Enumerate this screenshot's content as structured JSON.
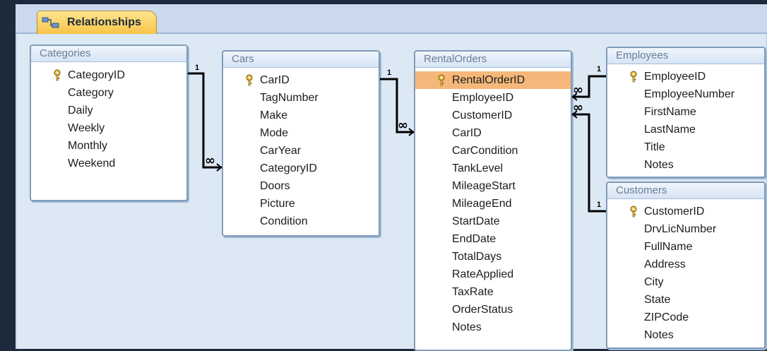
{
  "tab": {
    "label": "Relationships",
    "icon": "relationships-icon"
  },
  "tables": [
    {
      "name": "Categories",
      "fields": [
        "CategoryID",
        "Category",
        "Daily",
        "Weekly",
        "Monthly",
        "Weekend"
      ],
      "key": 0
    },
    {
      "name": "Cars",
      "fields": [
        "CarID",
        "TagNumber",
        "Make",
        "Mode",
        "CarYear",
        "CategoryID",
        "Doors",
        "Picture",
        "Condition"
      ],
      "key": 0
    },
    {
      "name": "RentalOrders",
      "fields": [
        "RentalOrderID",
        "EmployeeID",
        "CustomerID",
        "CarID",
        "CarCondition",
        "TankLevel",
        "MileageStart",
        "MileageEnd",
        "StartDate",
        "EndDate",
        "TotalDays",
        "RateApplied",
        "TaxRate",
        "OrderStatus",
        "Notes"
      ],
      "key": 0,
      "selected": 0
    },
    {
      "name": "Employees",
      "fields": [
        "EmployeeID",
        "EmployeeNumber",
        "FirstName",
        "LastName",
        "Title",
        "Notes"
      ],
      "key": 0
    },
    {
      "name": "Customers",
      "fields": [
        "CustomerID",
        "DrvLicNumber",
        "FullName",
        "Address",
        "City",
        "State",
        "ZIPCode",
        "Notes"
      ],
      "key": 0
    }
  ],
  "relationships": [
    {
      "one": "1",
      "many": "∞"
    },
    {
      "one": "1",
      "many": "∞"
    },
    {
      "one": "1",
      "many": "∞"
    },
    {
      "one": "1",
      "many": "∞"
    }
  ]
}
